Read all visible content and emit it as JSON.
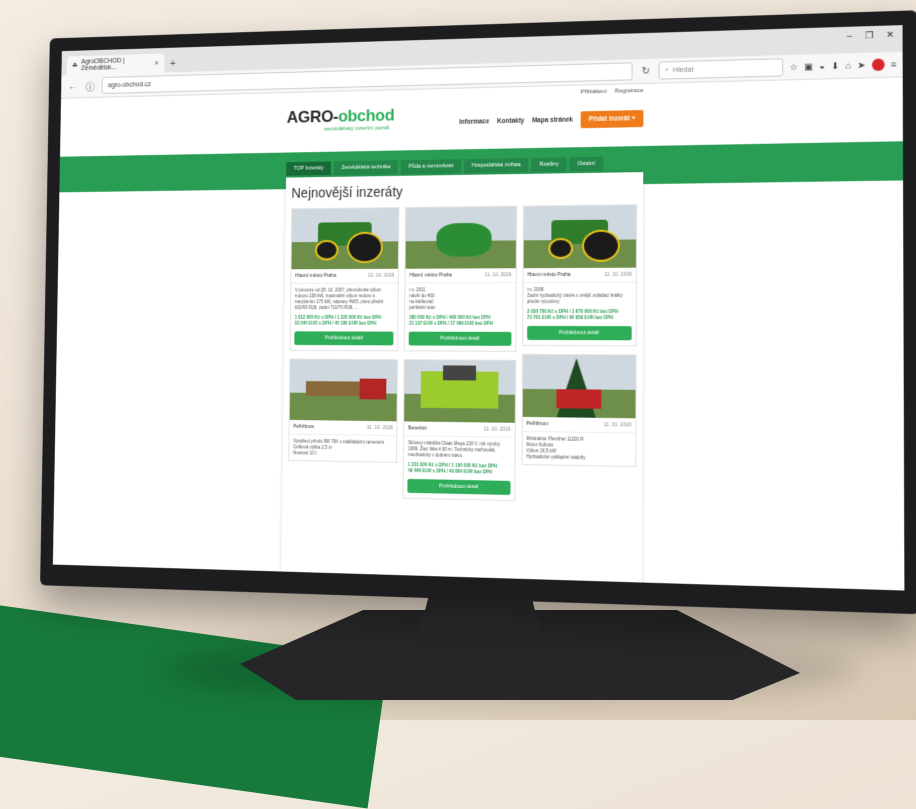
{
  "browser": {
    "tab_title": "AgroOBCHOD | Zemědělsk...",
    "url": "agro-obchod.cz",
    "search_placeholder": "Hledat"
  },
  "header": {
    "login": "Přihlášení",
    "register": "Registrace",
    "brand_main": "AGRO-",
    "brand_accent": "obchod",
    "tagline": "zemědělský inzertní portál",
    "nav": [
      "Informace",
      "Kontakty",
      "Mapa stránek"
    ],
    "add_button": "Přidat inzerát  +"
  },
  "categories": [
    {
      "label": "TOP Inzeráty",
      "active": true
    },
    {
      "label": "Zemědělská technika",
      "active": false
    },
    {
      "label": "Půda a nemovitosti",
      "active": false
    },
    {
      "label": "Hospodářská zvířata",
      "active": false
    },
    {
      "label": "Rostliny",
      "active": false
    },
    {
      "label": "Ostatní",
      "active": false
    }
  ],
  "section_title": "Nejnovější inzeráty",
  "detail_label": "Prohlédnout detail",
  "listings": [
    {
      "location": "Hlavní město Praha",
      "date": "12. 10. 2016",
      "desc": "V provozu od 28. 10. 2007, převodovka výkon motoru 158 kW, maximální výkon motoru s navýšením 175 kW, nápravy 4WD, pneu přední 600/65 R28, zadní 710/70 R38, ...",
      "price": "1 012 000 Kč s DPH / 1 220 000 Kč bez DPH\n33 040 EUR s DPH / 45 180 EUR bez DPH"
    },
    {
      "location": "Hlavní město Praha",
      "date": "11. 10. 2016",
      "desc": "r.v. 2011\nnávěr do 400\nna balíkovač\nperfektní stav",
      "price": "380 000 Kč s DPH / 480 000 Kč bez DPH\n21 137 EUR s DPH / 17 469 EUR bez DPH"
    },
    {
      "location": "Hlavní město Praha",
      "date": "11. 10. 2016",
      "desc": "r.v. 2008\nZadní hydraulický závěs s vnější ovládací krátký přední vývodový",
      "price": "2 030 700 Kč s DPH / 1 670 000 Kč bez DPH\n73 761 EUR s DPH / 60 959 EUR bez DPH"
    },
    {
      "location": "Pelhřimov",
      "date": "11. 10. 2016",
      "desc": "Vyvážecí přívěs BR 70K s nakládacím ramenem\nCelková výška 2,5 m\nNosnost 10 t",
      "price": ""
    },
    {
      "location": "Benešov",
      "date": "11. 10. 2016",
      "desc": "Sklízecí mlátička Claas Mega 218 V, rok výroby 1996. Žací lišta 4,60 m. Technicky zachovalá, mechanicky v dobrém stavu.",
      "price": "1 331 000 Kč s DPH / 1 100 000 Kč bez DPH\n49 446 EUR s DPH / 40 864 EUR bez DPH"
    },
    {
      "location": "Pelhřimov",
      "date": "11. 10. 2016",
      "desc": "Minitraktor Pleinther 11200 R\nMotor Kubota\nVýkon 18,5 kW\nHydraulické vyklápění nádoby",
      "price": ""
    }
  ]
}
